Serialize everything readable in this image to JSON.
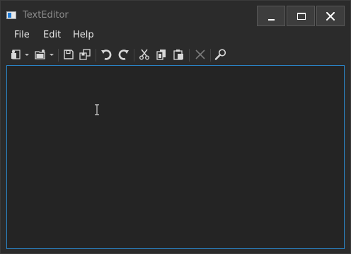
{
  "window": {
    "title": "TextEditor",
    "border_color": "#3a3a3a",
    "background": "#2b2b2b"
  },
  "titlebar": {
    "buttons": [
      {
        "name": "minimize",
        "icon": "minimize-icon"
      },
      {
        "name": "maximize",
        "icon": "maximize-icon"
      },
      {
        "name": "close",
        "icon": "close-icon"
      }
    ]
  },
  "menu": {
    "file_label": "File",
    "edit_label": "Edit",
    "help_label": "Help"
  },
  "toolbar": {
    "items": [
      {
        "name": "new-document",
        "icon": "new-document-icon",
        "dropdown": true
      },
      {
        "name": "open",
        "icon": "open-folder-icon",
        "dropdown": true
      },
      {
        "name": "save",
        "icon": "save-icon"
      },
      {
        "name": "save-as",
        "icon": "save-as-icon"
      },
      {
        "name": "undo",
        "icon": "undo-icon"
      },
      {
        "name": "redo",
        "icon": "redo-icon"
      },
      {
        "name": "cut",
        "icon": "cut-icon"
      },
      {
        "name": "copy",
        "icon": "copy-icon"
      },
      {
        "name": "paste",
        "icon": "paste-icon"
      },
      {
        "name": "delete",
        "icon": "delete-icon",
        "disabled": true
      },
      {
        "name": "find",
        "icon": "find-icon"
      }
    ]
  },
  "editor": {
    "content": "",
    "accent_color": "#2a84c6",
    "background": "#242424"
  }
}
